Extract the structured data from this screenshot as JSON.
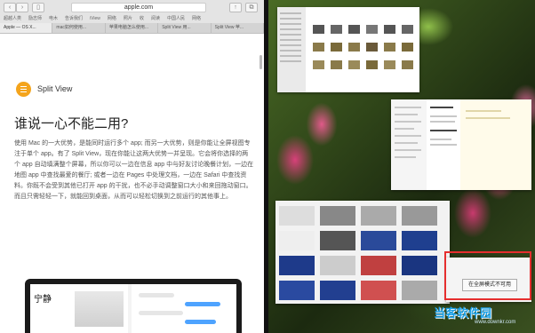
{
  "browser": {
    "url": "apple.com",
    "bookmarks": [
      "超越人类",
      "励志师",
      "电木",
      "告诉我们",
      "iView",
      "网络",
      "照片",
      "收",
      "阅读",
      "中国人民",
      "网络"
    ],
    "tabs": [
      "Apple — OS X...",
      "mac如何使用...",
      "苹果电脑怎么使用...",
      "Split View 用...",
      "Split View 苹..."
    ]
  },
  "article": {
    "feature_name": "Split View",
    "heading": "谁说一心不能二用?",
    "paragraph": "使用 Mac 的一大优势，是能同时运行多个 app; 而另一大优势，则是你能让全屏视图专注于单个 app。有了 Split View，现在你能让这两大优势一并呈现。它会将你选择的两个 app 自动填满整个屏幕，所以你可以一边在信息 app 中与好友讨论晚餐计划，一边在地图 app 中查找最爱的餐厅; 或者一边在 Pages 中处理文档，一边在 Safari 中查找资料。你既不会受到其他已打开 app 的干扰，也不必手动调整窗口大小和来回拖动窗口。而且只需轻轻一下，就能回到桌面，从而可以轻松切换到之前运行的其他事上。",
    "laptop_text": "宁静"
  },
  "mission_control": {
    "tooltip": "在全屏模式不可用"
  },
  "watermark": {
    "brand": "当客软件园",
    "site": "www.downkr.com"
  },
  "colors": {
    "accent_logo": "#f4a41c",
    "highlight_border": "#e62e2e",
    "watermark": "#1aa0e8"
  }
}
